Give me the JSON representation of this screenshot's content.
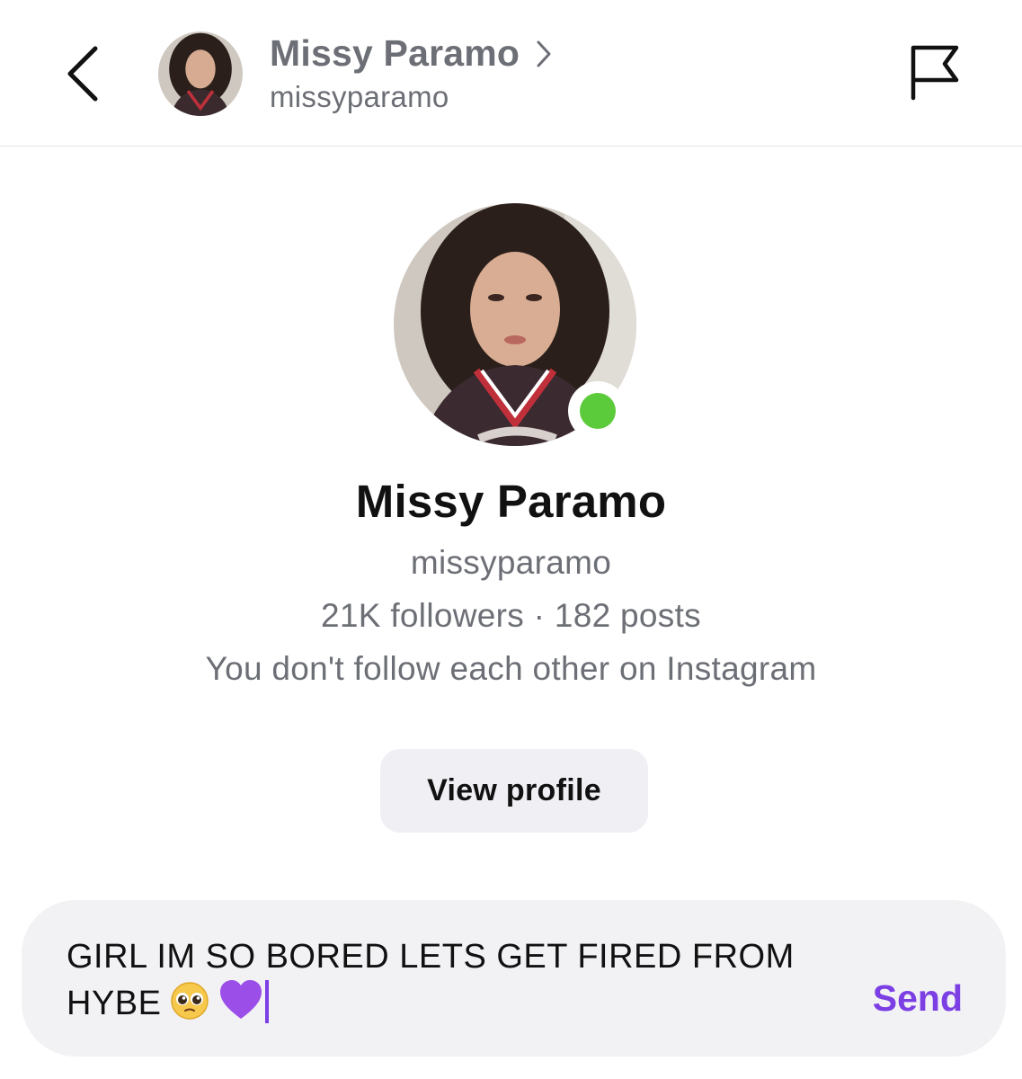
{
  "header": {
    "name": "Missy Paramo",
    "username": "missyparamo"
  },
  "profile": {
    "name": "Missy Paramo",
    "username": "missyparamo",
    "stats": "21K followers · 182 posts",
    "follow_status": "You don't follow each other on Instagram",
    "online": true,
    "view_profile_label": "View profile"
  },
  "composer": {
    "message_text": "GIRL IM SO BORED LETS GET FIRED FROM HYBE",
    "emojis": [
      "pleading-face-emoji",
      "purple-heart-emoji"
    ],
    "send_label": "Send"
  },
  "colors": {
    "accent": "#7b3fe4",
    "online": "#5ccb3b",
    "muted_text": "#6d6f76",
    "button_bg": "#efeff4",
    "composer_bg": "#f2f2f5"
  },
  "icons": {
    "back": "chevron-left-icon",
    "name_chevron": "chevron-right-icon",
    "report": "flag-icon"
  }
}
